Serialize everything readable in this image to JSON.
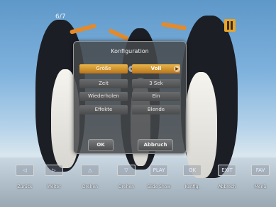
{
  "status": {
    "page_indicator": "6/7"
  },
  "dialog": {
    "title": "Konfiguration",
    "rows": [
      {
        "label": "Größe",
        "value": "Voll",
        "selected": true
      },
      {
        "label": "Zeit",
        "value": "3 Sek",
        "selected": false
      },
      {
        "label": "Wiederholen",
        "value": "Ein",
        "selected": false
      },
      {
        "label": "Effekte",
        "value": "Blende",
        "selected": false
      }
    ],
    "ok_label": "OK",
    "cancel_label": "Abbruch"
  },
  "toolbar": {
    "items": [
      {
        "icon": "◁",
        "label": "Zurück"
      },
      {
        "icon": "▷",
        "label": "Weiter"
      },
      {
        "icon": "△",
        "label": "Drehen"
      },
      {
        "icon": "▽",
        "label": "Drehen"
      },
      {
        "icon": "PLAY",
        "label": "Slide Show"
      },
      {
        "icon": "OK",
        "label": "Konfig."
      },
      {
        "icon": "EXIT",
        "label": "Abbrech"
      },
      {
        "icon": "FAV",
        "label": "Menü"
      }
    ]
  },
  "colors": {
    "accent": "#e6a52b",
    "dialog_bg": "#46484a"
  }
}
